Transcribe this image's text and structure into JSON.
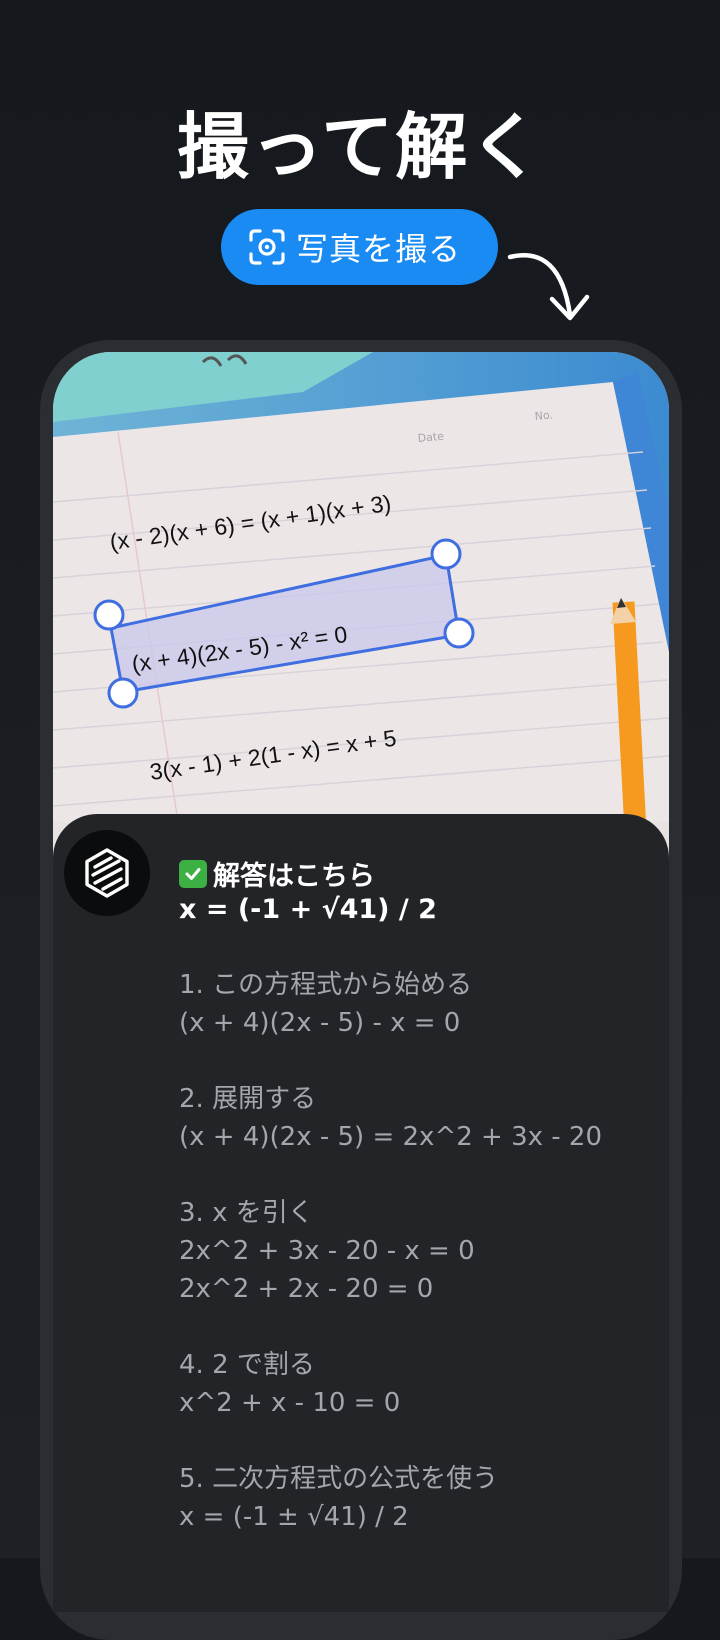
{
  "headline": "撮って解く",
  "cta": {
    "label": "写真を撮る",
    "icon": "camera-scan-icon"
  },
  "photo": {
    "equations": [
      "(x - 2)(x + 6) = (x + 1)(x + 3)",
      "(x + 4)(2x - 5) - x² = 0",
      "3(x - 1) + 2(1 - x) = x + 5"
    ],
    "date_label": "Date",
    "no_label": "No."
  },
  "answer": {
    "title": "解答はこちら",
    "result": "x = (-1 + √41) / 2",
    "steps": [
      {
        "lines": [
          "1. この方程式から始める",
          "(x + 4)(2x - 5) - x = 0"
        ]
      },
      {
        "lines": [
          "2. 展開する",
          "(x + 4)(2x - 5) = 2x^2 + 3x - 20"
        ]
      },
      {
        "lines": [
          "3. x を引く",
          "2x^2 + 3x - 20 - x = 0",
          "2x^2 + 2x - 20 = 0"
        ]
      },
      {
        "lines": [
          "4. 2 で割る",
          "x^2 + x - 10 = 0"
        ]
      },
      {
        "lines": [
          "5. 二次方程式の公式を使う",
          "x = (-1 ± √41) / 2"
        ]
      }
    ]
  },
  "colors": {
    "accent": "#1a8bf2",
    "background": "#15181d",
    "sheet": "#222428",
    "selection": "#3f6ee0",
    "pencil": "#f59a1e"
  }
}
